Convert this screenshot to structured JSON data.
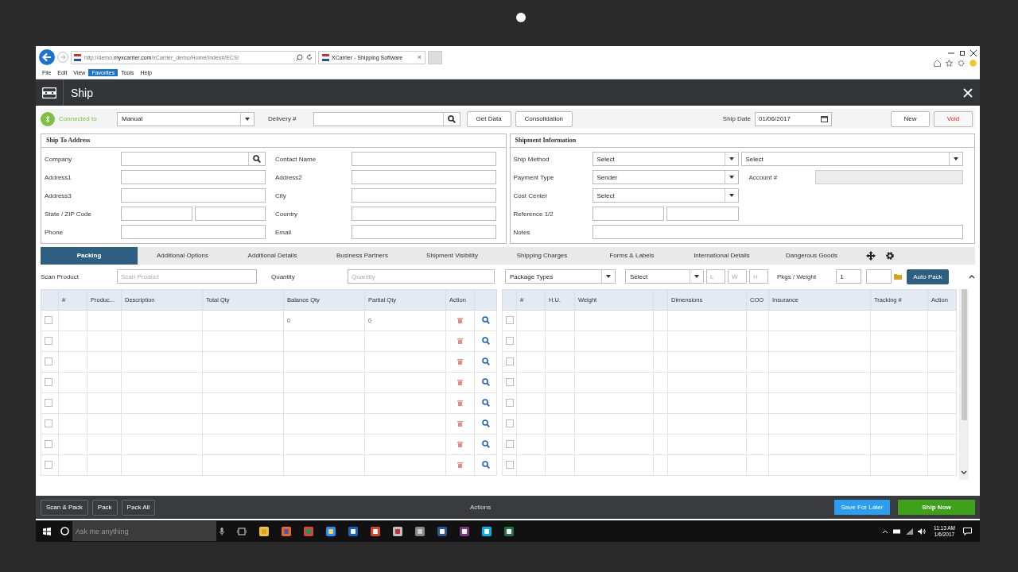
{
  "browser": {
    "url": "http://demo.**myxcarrier.com**/xCarrier_demo/Home/Index#/ECS/",
    "tab_title": "XCarrier - Shipping Software",
    "tab_close": "×",
    "menu": [
      {
        "label": "File",
        "selected": false
      },
      {
        "label": "Edit",
        "selected": false
      },
      {
        "label": "View",
        "selected": false
      },
      {
        "label": "Favorites",
        "selected": true
      },
      {
        "label": "Tools",
        "selected": false
      },
      {
        "label": "Help",
        "selected": false
      }
    ]
  },
  "app": {
    "title": "Ship"
  },
  "toolbar": {
    "status": "Connected to",
    "source": "Manual",
    "delivery_label": "Delivery #",
    "buttons": [
      "Get Data",
      "Consolidation"
    ],
    "ship_date_label": "Ship Date",
    "ship_date": "01/06/2017",
    "new": "New",
    "void": "Void"
  },
  "ship_to": {
    "title": "Ship To Address",
    "fields": [
      {
        "label": "Company",
        "kind": "search"
      },
      {
        "label": "Contact Name",
        "kind": "text"
      },
      {
        "label": "Address1",
        "kind": "text"
      },
      {
        "label": "Address2",
        "kind": "text"
      },
      {
        "label": "Address3",
        "kind": "text"
      },
      {
        "label": "City",
        "kind": "text"
      },
      {
        "label": "State / ZIP Code",
        "kind": "split"
      },
      {
        "label": "Country",
        "kind": "text"
      },
      {
        "label": "Phone",
        "kind": "text"
      },
      {
        "label": "Email",
        "kind": "text"
      }
    ]
  },
  "shipment": {
    "title": "Shipment Information",
    "rows": [
      {
        "label": "Ship Method",
        "kind": "select-pair",
        "value": "Select",
        "value2": "Select"
      },
      {
        "label": "Payment Type",
        "kind": "select-account",
        "value": "Sender",
        "label2": "Account #"
      },
      {
        "label": "Cost Center",
        "kind": "select",
        "value": "Select"
      },
      {
        "label": "Reference 1/2",
        "kind": "split"
      },
      {
        "label": "Notes",
        "kind": "wide"
      }
    ]
  },
  "tabs": [
    {
      "label": "Packing",
      "selected": true
    },
    {
      "label": "Additional Options",
      "selected": false
    },
    {
      "label": "Additional Details",
      "selected": false
    },
    {
      "label": "Business Partners",
      "selected": false
    },
    {
      "label": "Shipment Visibility",
      "selected": false
    },
    {
      "label": "Shipping Charges",
      "selected": false
    },
    {
      "label": "Forms & Labels",
      "selected": false
    },
    {
      "label": "International Details",
      "selected": false
    },
    {
      "label": "Dangerous Goods",
      "selected": false
    }
  ],
  "scan": {
    "scan_label": "Scan Product",
    "scan_placeholder": "Scan Product",
    "qty_label": "Quantity",
    "qty_placeholder": "Quantity",
    "package_types": "Package Types",
    "package_select": "Select",
    "dim_placeholders": [
      "L",
      "W",
      "H"
    ],
    "pkgs_label": "Pkgs / Weight",
    "pkgs": "1",
    "auto_pack": "Auto Pack"
  },
  "items_table": {
    "columns": [
      "#",
      "Produc...",
      "Description",
      "Total Qty",
      "Balance Qty",
      "Partial Qty",
      "Action"
    ],
    "rows": [
      {
        "checked": false,
        "balance": "0",
        "partial": "0"
      },
      {
        "checked": false
      },
      {
        "checked": false
      },
      {
        "checked": false
      },
      {
        "checked": false
      },
      {
        "checked": false
      },
      {
        "checked": false
      },
      {
        "checked": false
      }
    ]
  },
  "packages_table": {
    "columns": [
      "#",
      "H.U.",
      "Weight",
      "",
      "Dimensions",
      "COO",
      "Insurance",
      "Tracking #",
      "Action"
    ],
    "rows": [
      {
        "checked": false
      },
      {
        "checked": false
      },
      {
        "checked": false
      },
      {
        "checked": false
      },
      {
        "checked": false
      },
      {
        "checked": false
      },
      {
        "checked": false
      },
      {
        "checked": false
      }
    ]
  },
  "actions": {
    "left": [
      "Scan & Pack",
      "Pack",
      "Pack All"
    ],
    "title": "Actions",
    "save": "Save For Later",
    "ship": "Ship Now"
  },
  "taskbar": {
    "search_placeholder": "Ask me anything",
    "time": "11:13 AM",
    "date": "1/6/2017"
  }
}
